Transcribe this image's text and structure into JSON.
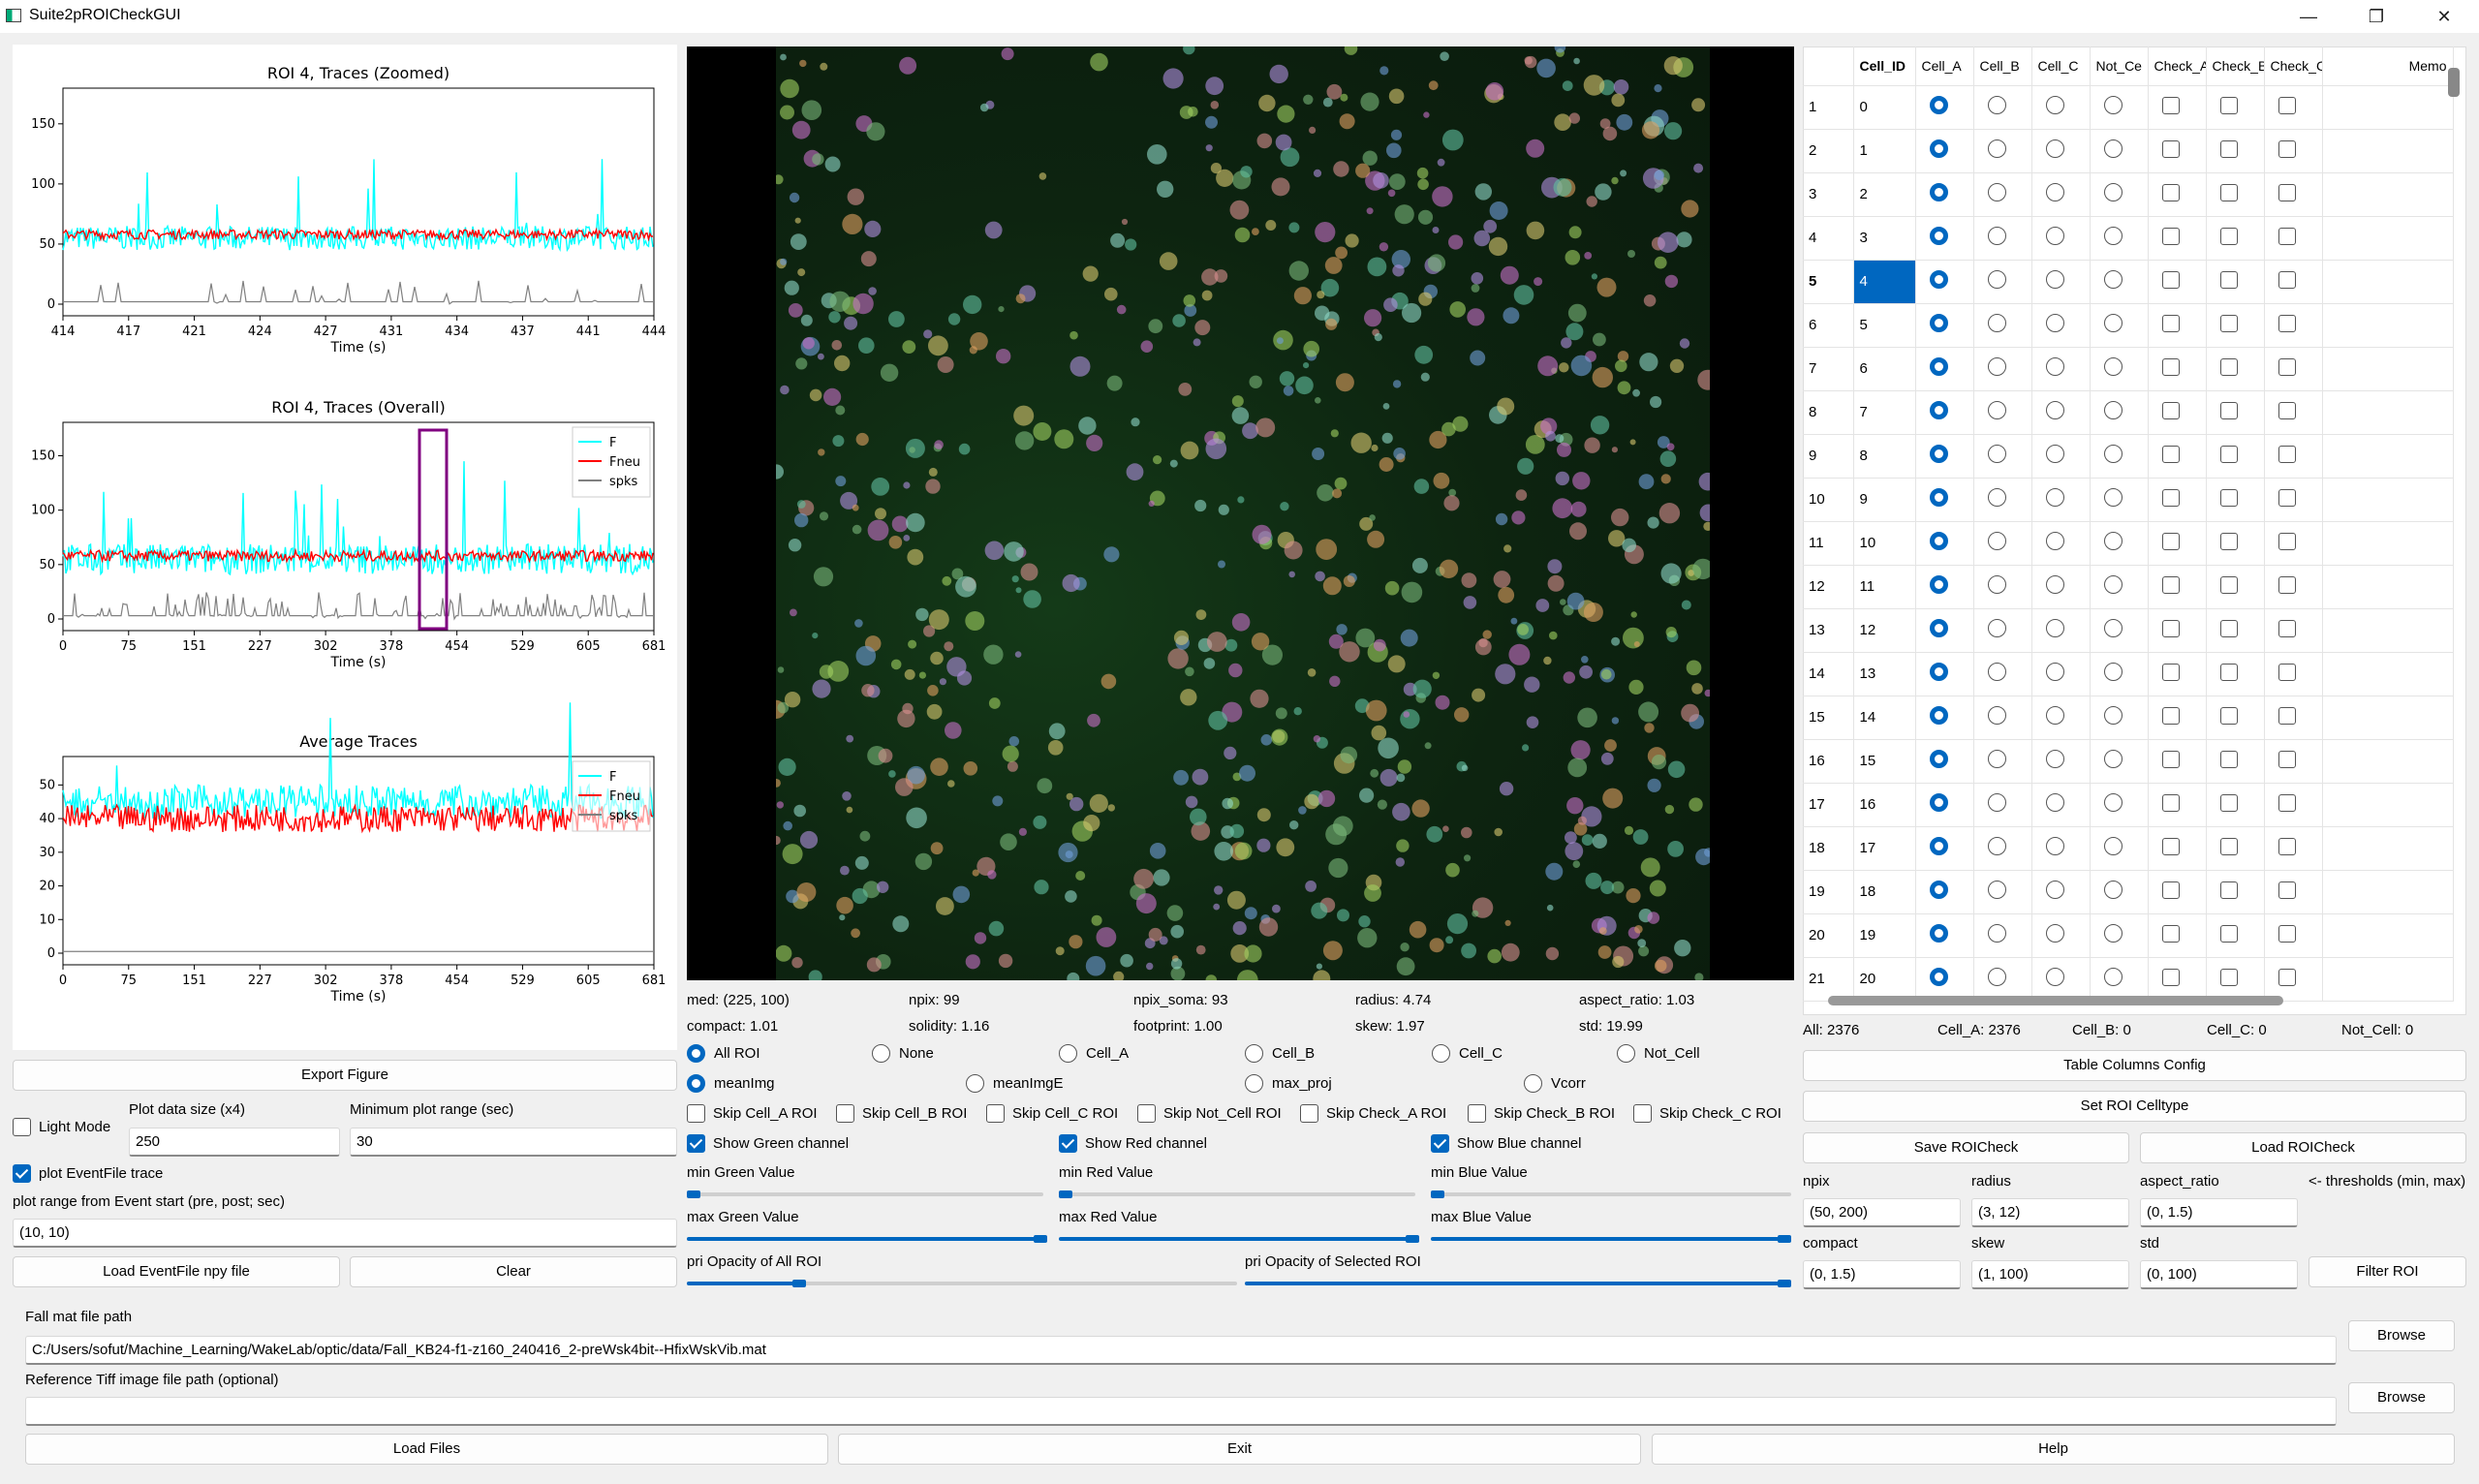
{
  "window": {
    "title": "Suite2pROICheckGUI",
    "minimize": "—",
    "restore": "❐",
    "close": "✕"
  },
  "plots": {
    "zoomed": {
      "title": "ROI 4, Traces (Zoomed)",
      "xlabel": "Time (s)",
      "xticks": [
        "414",
        "417",
        "421",
        "424",
        "427",
        "431",
        "434",
        "437",
        "441",
        "444"
      ],
      "yticks": [
        "0",
        "50",
        "100",
        "150"
      ]
    },
    "overall": {
      "title": "ROI 4, Traces (Overall)",
      "xlabel": "Time (s)",
      "xticks": [
        "0",
        "75",
        "151",
        "227",
        "302",
        "378",
        "454",
        "529",
        "605",
        "681"
      ],
      "yticks": [
        "0",
        "50",
        "100",
        "150"
      ],
      "legend": [
        "F",
        "Fneu",
        "spks"
      ]
    },
    "average": {
      "title": "Average Traces",
      "xlabel": "Time (s)",
      "xticks": [
        "0",
        "75",
        "151",
        "227",
        "302",
        "378",
        "454",
        "529",
        "605",
        "681"
      ],
      "yticks": [
        "0",
        "10",
        "20",
        "30",
        "40",
        "50"
      ],
      "legend": [
        "F",
        "Fneu",
        "spks"
      ]
    },
    "colors": {
      "F": "#00ffff",
      "Fneu": "#ff0000",
      "spks": "#808080",
      "highlight": "#800080"
    }
  },
  "left": {
    "export": "Export Figure",
    "light_mode": "Light Mode",
    "plot_size_label": "Plot data size (x4)",
    "plot_size": "250",
    "min_range_label": "Minimum plot range (sec)",
    "min_range": "30",
    "plot_event": "plot EventFile trace",
    "event_range_label": "plot range from Event start (pre, post; sec)",
    "event_range": "(10, 10)",
    "load_event": "Load EventFile npy file",
    "clear": "Clear"
  },
  "stats": {
    "med": "med: (225, 100)",
    "npix": "npix: 99",
    "npix_soma": "npix_soma: 93",
    "radius": "radius: 4.74",
    "aspect": "aspect_ratio: 1.03",
    "compact": "compact: 1.01",
    "solidity": "solidity: 1.16",
    "footprint": "footprint: 1.00",
    "skew": "skew: 1.97",
    "std": "std: 19.99"
  },
  "roi_radios": [
    "All ROI",
    "None",
    "Cell_A",
    "Cell_B",
    "Cell_C",
    "Not_Cell"
  ],
  "bg_radios": [
    "meanImg",
    "meanImgE",
    "max_proj",
    "Vcorr"
  ],
  "skips": [
    "Skip Cell_A ROI",
    "Skip Cell_B ROI",
    "Skip Cell_C ROI",
    "Skip Not_Cell ROI",
    "Skip Check_A ROI",
    "Skip Check_B ROI",
    "Skip Check_C ROI"
  ],
  "channels": [
    "Show Green channel",
    "Show Red channel",
    "Show Blue channel"
  ],
  "sliders": {
    "min_green": "min Green Value",
    "min_red": "min Red Value",
    "min_blue": "min Blue Value",
    "max_green": "max Green Value",
    "max_red": "max Red Value",
    "max_blue": "max Blue Value",
    "opacity_all": "pri Opacity of All ROI",
    "opacity_sel": "pri Opacity of Selected ROI"
  },
  "table": {
    "headers": [
      "Cell_ID",
      "Cell_A",
      "Cell_B",
      "Cell_C",
      "Not_Ce",
      "Check_A",
      "Check_B",
      "Check_C",
      "Memo"
    ],
    "row_headers": [
      "1",
      "2",
      "3",
      "4",
      "5",
      "6",
      "7",
      "8",
      "9",
      "10",
      "11",
      "12",
      "13",
      "14",
      "15",
      "16",
      "17",
      "18",
      "19",
      "20",
      "21"
    ],
    "cell_ids": [
      "0",
      "1",
      "2",
      "3",
      "4",
      "5",
      "6",
      "7",
      "8",
      "9",
      "10",
      "11",
      "12",
      "13",
      "14",
      "15",
      "16",
      "17",
      "18",
      "19",
      "20"
    ]
  },
  "counts": {
    "all": "All: 2376",
    "a": "Cell_A: 2376",
    "b": "Cell_B: 0",
    "c": "Cell_C: 0",
    "not": "Not_Cell: 0"
  },
  "right": {
    "table_config": "Table Columns Config",
    "set_celltype": "Set ROI Celltype",
    "save": "Save ROICheck",
    "load": "Load ROICheck",
    "npix_l": "npix",
    "radius_l": "radius",
    "aspect_l": "aspect_ratio",
    "thresh_l": "<- thresholds (min, max)",
    "npix": "(50, 200)",
    "radius": "(3, 12)",
    "aspect": "(0, 1.5)",
    "compact_l": "compact",
    "skew_l": "skew",
    "std_l": "std",
    "compact": "(0, 1.5)",
    "skew": "(1, 100)",
    "std": "(0, 100)",
    "filter": "Filter ROI"
  },
  "bottom": {
    "fall_label": "Fall mat file path",
    "fall_path": "C:/Users/sofut/Machine_Learning/WakeLab/optic/data/Fall_KB24-f1-z160_240416_2-preWsk4bit--HfixWskVib.mat",
    "tiff_label": "Reference Tiff image file path (optional)",
    "tiff_path": "",
    "browse": "Browse",
    "load": "Load Files",
    "exit": "Exit",
    "help": "Help"
  }
}
